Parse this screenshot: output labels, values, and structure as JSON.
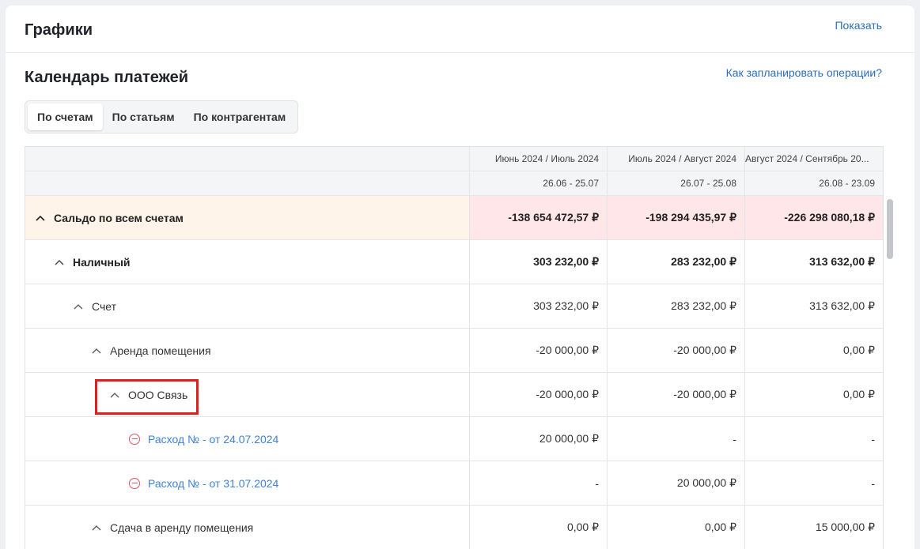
{
  "charts_section": {
    "title": "Графики",
    "show_label": "Показать"
  },
  "calendar": {
    "title": "Календарь платежей",
    "help_link": "Как запланировать операции?",
    "tabs": [
      {
        "label": "По счетам",
        "active": true
      },
      {
        "label": "По статьям",
        "active": false
      },
      {
        "label": "По контрагентам",
        "active": false
      }
    ],
    "columns": [
      {
        "period": "Июнь 2024 / Июль 2024",
        "range": "26.06 - 25.07"
      },
      {
        "period": "Июль 2024 / Август 2024",
        "range": "26.07 - 25.08"
      },
      {
        "period": "Август 2024 / Сентябрь 20...",
        "range": "26.08 - 23.09"
      }
    ],
    "rows": [
      {
        "label": "Сальдо по всем счетам",
        "values": [
          "-138 654 472,57 ₽",
          "-198 294 435,97 ₽",
          "-226 298 080,18 ₽"
        ]
      },
      {
        "label": "Наличный",
        "values": [
          "303 232,00 ₽",
          "283 232,00 ₽",
          "313 632,00 ₽"
        ]
      },
      {
        "label": "Счет",
        "values": [
          "303 232,00 ₽",
          "283 232,00 ₽",
          "313 632,00 ₽"
        ]
      },
      {
        "label": "Аренда помещения",
        "values": [
          "-20 000,00 ₽",
          "-20 000,00 ₽",
          "0,00 ₽"
        ]
      },
      {
        "label": "ООО Связь",
        "values": [
          "-20 000,00 ₽",
          "-20 000,00 ₽",
          "0,00 ₽"
        ]
      },
      {
        "label": "Расход № - от 24.07.2024",
        "values": [
          "20 000,00 ₽",
          "-",
          "-"
        ]
      },
      {
        "label": "Расход № - от 31.07.2024",
        "values": [
          "-",
          "20 000,00 ₽",
          "-"
        ]
      },
      {
        "label": "Сдача в аренду помещения",
        "values": [
          "0,00 ₽",
          "0,00 ₽",
          "15 000,00 ₽"
        ]
      }
    ]
  },
  "colors": {
    "link": "#2c6fbb",
    "saldo_row": "#fff4ea",
    "negative_cell": "#ffe6e8",
    "expense_icon": "#e05561",
    "highlight": "#e01e1e"
  },
  "icons": {
    "expand": "chevron-up-icon",
    "expense": "minus-circle-icon"
  }
}
